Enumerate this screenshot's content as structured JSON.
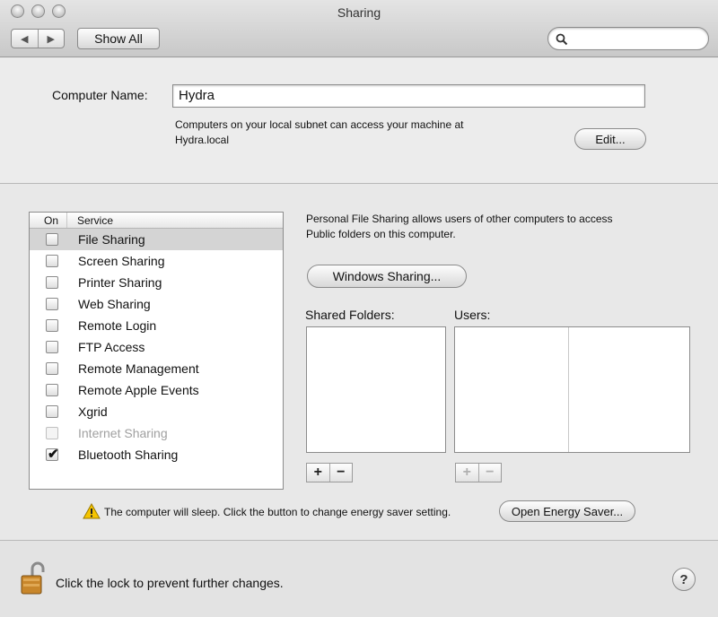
{
  "window": {
    "title": "Sharing"
  },
  "toolbar": {
    "back_label": "◀",
    "forward_label": "▶",
    "show_all_label": "Show All",
    "search_placeholder": ""
  },
  "computer_name": {
    "label": "Computer Name:",
    "value": "Hydra",
    "description_line1": "Computers on your local subnet can access your machine at",
    "description_line2": "Hydra.local",
    "edit_label": "Edit..."
  },
  "services": {
    "header_on": "On",
    "header_service": "Service",
    "items": [
      {
        "name": "File Sharing",
        "checked": false,
        "enabled": true,
        "selected": true
      },
      {
        "name": "Screen Sharing",
        "checked": false,
        "enabled": true,
        "selected": false
      },
      {
        "name": "Printer Sharing",
        "checked": false,
        "enabled": true,
        "selected": false
      },
      {
        "name": "Web Sharing",
        "checked": false,
        "enabled": true,
        "selected": false
      },
      {
        "name": "Remote Login",
        "checked": false,
        "enabled": true,
        "selected": false
      },
      {
        "name": "FTP Access",
        "checked": false,
        "enabled": true,
        "selected": false
      },
      {
        "name": "Remote Management",
        "checked": false,
        "enabled": true,
        "selected": false
      },
      {
        "name": "Remote Apple Events",
        "checked": false,
        "enabled": true,
        "selected": false
      },
      {
        "name": "Xgrid",
        "checked": false,
        "enabled": true,
        "selected": false
      },
      {
        "name": "Internet Sharing",
        "checked": false,
        "enabled": false,
        "selected": false
      },
      {
        "name": "Bluetooth Sharing",
        "checked": true,
        "enabled": true,
        "selected": false
      }
    ]
  },
  "detail": {
    "description_line1": "Personal File Sharing allows users of other computers to access",
    "description_line2": "Public folders on this computer.",
    "windows_sharing_label": "Windows Sharing...",
    "shared_folders_label": "Shared Folders:",
    "users_label": "Users:",
    "plus_label": "+",
    "minus_label": "−"
  },
  "energy": {
    "warning_text": "The computer will sleep. Click the button to change energy saver setting.",
    "button_label": "Open Energy Saver..."
  },
  "lock": {
    "text": "Click the lock to prevent further changes.",
    "help_label": "?"
  },
  "colors": {
    "window_bg": "#e8e8e8",
    "selected_row": "#d4d4d4",
    "disabled_text": "#a0a0a0",
    "warning_yellow": "#f5c400",
    "lock_gold": "#c8862a"
  }
}
